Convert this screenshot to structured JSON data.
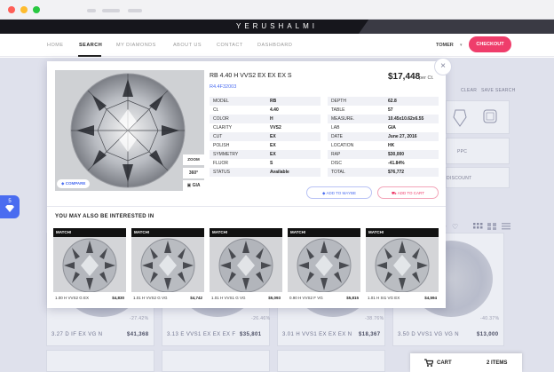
{
  "brand": "YERUSHALMI",
  "nav": {
    "items": [
      "HOME",
      "SEARCH",
      "MY DIAMONDS",
      "ABOUT US",
      "CONTACT",
      "DASHBOARD"
    ],
    "user": "TOMER",
    "checkout": "CHECKOUT"
  },
  "side_tab": {
    "count": "5"
  },
  "backdrop": {
    "clear": "CLEAR",
    "save_search": "SAVE SEARCH",
    "ppc": "PPC",
    "discount": "DISCOUNT",
    "cards": [
      {
        "discount": "-27.42%",
        "desc": "3.27 D IF EX VG N",
        "price": "$41,368"
      },
      {
        "discount": "",
        "desc": "3.13 E VVS1 EX EX EX F",
        "price": "$35,801"
      },
      {
        "discount": "-26.46%",
        "desc": "3.01 H VVS1 EX EX EX N",
        "price": "$18,367"
      },
      {
        "discount": "-38.76%",
        "desc": "3.11 D VVS1 EX VG N",
        "price": "$18,367"
      },
      {
        "discount": "-40.37%",
        "desc": "3.50 D VVS1 VG VG N",
        "price": "$13,000"
      }
    ]
  },
  "cart": {
    "label": "CART",
    "count": "2 ITEMS"
  },
  "modal": {
    "close": "×",
    "title": "RB 4.40 H VVS2 EX EX EX S",
    "sku": "R4.4F32003",
    "price": "$17,448",
    "price_unit": "per Ct.",
    "compare": "COMPARE",
    "zoom": "ZOOM",
    "spin": "360°",
    "gia": "GIA",
    "specs_left": [
      {
        "k": "MODEL",
        "v": "RB"
      },
      {
        "k": "Ct.",
        "v": "4.40"
      },
      {
        "k": "COLOR",
        "v": "H"
      },
      {
        "k": "CLARITY",
        "v": "VVS2"
      },
      {
        "k": "CUT",
        "v": "EX"
      },
      {
        "k": "POLISH",
        "v": "EX"
      },
      {
        "k": "SYMMETRY",
        "v": "EX"
      },
      {
        "k": "FLUOR",
        "v": "S"
      },
      {
        "k": "STATUS",
        "v": "Available"
      }
    ],
    "specs_right": [
      {
        "k": "DEPTH",
        "v": "62.8"
      },
      {
        "k": "TABLE",
        "v": "57"
      },
      {
        "k": "MEASURE.",
        "v": "10.45x10.62x6.55"
      },
      {
        "k": "LAB",
        "v": "GIA"
      },
      {
        "k": "DATE",
        "v": "June 27, 2016"
      },
      {
        "k": "LOCATION",
        "v": "HK"
      },
      {
        "k": "RAP",
        "v": "$30,000"
      },
      {
        "k": "DISC",
        "v": "-41.84%"
      },
      {
        "k": "TOTAL",
        "v": "$76,772"
      }
    ],
    "add_maybe": "ADD TO MAYBE",
    "add_cart": "ADD TO CART",
    "recommend_title": "YOU MAY ALSO BE INTERESTED IN",
    "recommendations": [
      {
        "badge": "MATCH!",
        "desc": "1.00 H VVS2 G EX",
        "price": "$4,830"
      },
      {
        "badge": "MATCH!",
        "desc": "1.01 H VVS2 G VG",
        "price": "$4,742"
      },
      {
        "badge": "MATCH!",
        "desc": "1.01 H VVS1 G VG",
        "price": "$5,093"
      },
      {
        "badge": "MATCH!",
        "desc": "0.90 H VVS2 F VG",
        "price": "$5,815"
      },
      {
        "badge": "MATCH!",
        "desc": "1.01 H SI1 VG EX",
        "price": "$4,594"
      }
    ]
  }
}
